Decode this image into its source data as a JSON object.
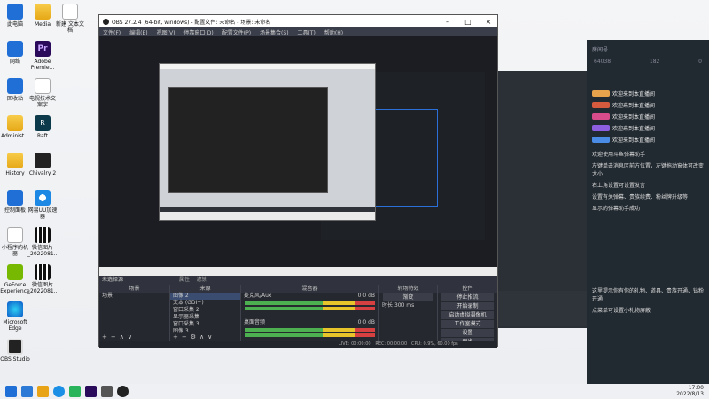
{
  "desktop_icons": [
    {
      "label": "此电脑",
      "icon": "computer-icon"
    },
    {
      "label": "Media",
      "icon": "folder-icon"
    },
    {
      "label": "新建 文本文档",
      "icon": "text-document-icon"
    },
    {
      "label": "网络",
      "icon": "network-icon"
    },
    {
      "label": "Adobe Premie...",
      "icon": "premiere-icon"
    },
    {
      "label": "回收站",
      "icon": "recycle-bin-icon"
    },
    {
      "label": "电视技术文案字",
      "icon": "document-icon"
    },
    {
      "label": "Administ...",
      "icon": "user-folder-icon"
    },
    {
      "label": "Raft",
      "icon": "raft-icon"
    },
    {
      "label": "History",
      "icon": "folder-icon"
    },
    {
      "label": "Chivalry 2",
      "icon": "chivalry-icon"
    },
    {
      "label": "控制面板",
      "icon": "control-panel-icon"
    },
    {
      "label": "网易UU加速器",
      "icon": "uu-accelerator-icon"
    },
    {
      "label": "小程序的机器",
      "icon": "document-icon"
    },
    {
      "label": "微信图片_2022081...",
      "icon": "image-icon"
    },
    {
      "label": "GeForce Experience",
      "icon": "geforce-icon"
    },
    {
      "label": "微信图片_2022081...",
      "icon": "image-icon"
    },
    {
      "label": "Microsoft Edge",
      "icon": "edge-icon"
    },
    {
      "label": "OBS Studio",
      "icon": "obs-icon"
    }
  ],
  "obs": {
    "title": "OBS 27.2.4 (64-bit, windows) - 配置文件: 未命名 - 场景: 未命名",
    "menu": [
      "文件(F)",
      "编辑(E)",
      "视图(V)",
      "停靠窗口(D)",
      "配置文件(P)",
      "场景集合(S)",
      "工具(T)",
      "帮助(H)"
    ],
    "docks_tab_active": "未选择源",
    "docks_tab_items": [
      "属性",
      "滤镜"
    ],
    "scenes": {
      "title": "场景",
      "items": [
        "场景"
      ]
    },
    "sources": {
      "title": "来源",
      "items": [
        "图像 2",
        "文本 (GDI+)",
        "窗口采集 2",
        "显示器采集",
        "窗口采集 3",
        "图像 3",
        "窗口采集"
      ]
    },
    "mixer": {
      "title": "混音器",
      "channels": [
        {
          "name": "麦克风/Aux",
          "db": "0.0 dB"
        },
        {
          "name": "桌面音频",
          "db": "0.0 dB"
        }
      ]
    },
    "transitions": {
      "title": "转场特效",
      "type": "渐变",
      "duration_label": "时长",
      "duration": "300 ms"
    },
    "controls": {
      "title": "控件",
      "buttons": [
        "停止推流",
        "开始录制",
        "启动虚拟摄像机",
        "工作室模式",
        "设置",
        "退出"
      ]
    },
    "status": {
      "live": "LIVE: 00:00:00",
      "rec": "REC: 00:00:00",
      "cpu": "CPU: 0.9%, 60.00 fps"
    }
  },
  "stream_panel": {
    "header": "房间号",
    "stats": [
      "64038",
      "182",
      "0"
    ],
    "messages": [
      {
        "text": "欢迎来到本直播间",
        "color": "#e7a34b"
      },
      {
        "text": "欢迎来到本直播间",
        "color": "#d65a3e"
      },
      {
        "text": "欢迎来到本直播间",
        "color": "#d94c8b"
      },
      {
        "text": "欢迎来到本直播间",
        "color": "#8d5fe0"
      },
      {
        "text": "欢迎来到本直播间",
        "color": "#4a8be6"
      }
    ],
    "system_notes": [
      "欢迎使用斗鱼弹幕助手",
      "左键单击消息区前方位置，左键拖动窗体可改变大小",
      "右上角设置可设置发言",
      "设置有关弹幕、贵族续费、粉丝牌升级等",
      "显示的弹幕助手成功"
    ],
    "bottom_notes": [
      "这里提示你有你的礼物、道具、贵族开通、钻粉开通",
      "点菜单可设置小礼物屏蔽"
    ]
  },
  "taskbar": {
    "time": "17:00",
    "date": "2022/8/13"
  }
}
